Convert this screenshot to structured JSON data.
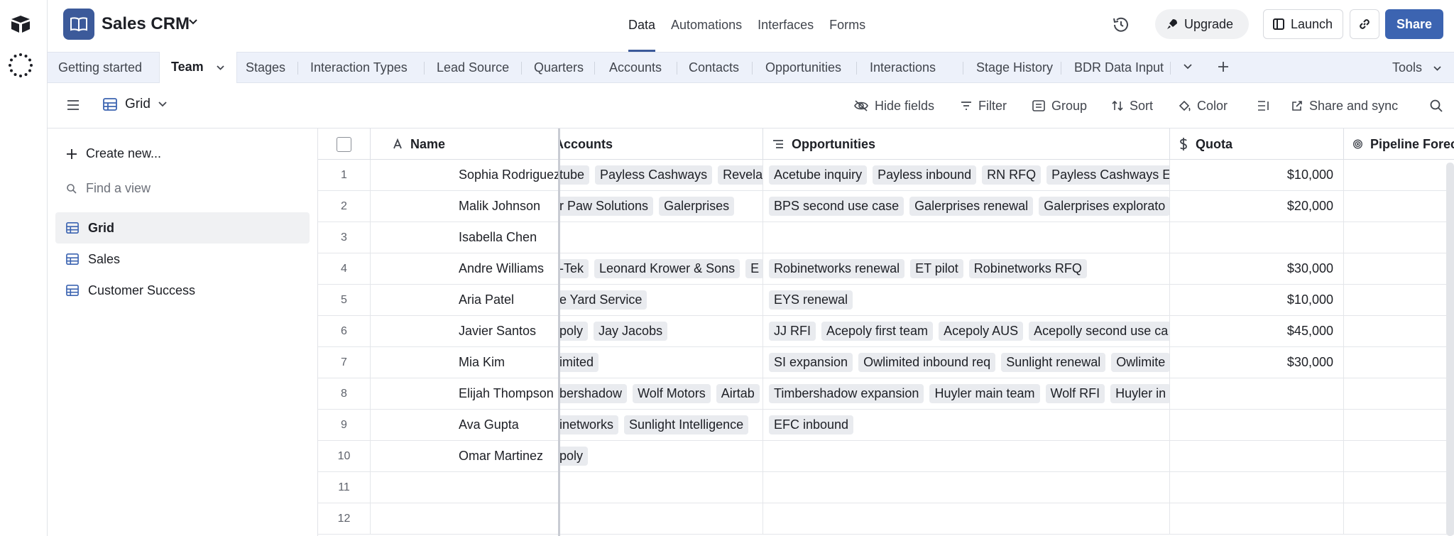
{
  "app": {
    "base_name": "Sales CRM",
    "nav": [
      {
        "label": "Data",
        "active": true
      },
      {
        "label": "Automations",
        "active": false
      },
      {
        "label": "Interfaces",
        "active": false
      },
      {
        "label": "Forms",
        "active": false
      }
    ],
    "upgrade_label": "Upgrade",
    "launch_label": "Launch",
    "share_label": "Share"
  },
  "tabs": {
    "items": [
      {
        "label": "Getting started"
      },
      {
        "label": "Team",
        "active": true
      },
      {
        "label": "Stages"
      },
      {
        "label": "Interaction Types"
      },
      {
        "label": "Lead Source"
      },
      {
        "label": "Quarters"
      },
      {
        "label": "Accounts"
      },
      {
        "label": "Contacts"
      },
      {
        "label": "Opportunities"
      },
      {
        "label": "Interactions"
      },
      {
        "label": "Stage History"
      },
      {
        "label": "BDR Data Input"
      }
    ],
    "tools_label": "Tools"
  },
  "viewbar": {
    "view_name": "Grid",
    "hide_fields": "Hide fields",
    "filter": "Filter",
    "group": "Group",
    "sort": "Sort",
    "color": "Color",
    "share_sync": "Share and sync"
  },
  "sidebar": {
    "create_new": "Create new...",
    "find_placeholder": "Find a view",
    "views": [
      {
        "label": "Grid",
        "active": true
      },
      {
        "label": "Sales",
        "active": false
      },
      {
        "label": "Customer Success",
        "active": false
      }
    ]
  },
  "grid": {
    "columns": {
      "name": "Name",
      "accounts": "Accounts",
      "opportunities": "Opportunities",
      "quota": "Quota",
      "pipeline": "Pipeline Forec"
    },
    "rows": [
      {
        "num": "1",
        "name": "Sophia Rodriguez",
        "accounts": [
          "tube",
          "Payless Cashways",
          "Revela"
        ],
        "opps": [
          "Acetube inquiry",
          "Payless inbound",
          "RN RFQ",
          "Payless Cashways E"
        ],
        "quota": "$10,000"
      },
      {
        "num": "2",
        "name": "Malik Johnson",
        "accounts": [
          "r Paw Solutions",
          "Galerprises"
        ],
        "opps": [
          "BPS second use case",
          "Galerprises renewal",
          "Galerprises explorato"
        ],
        "quota": "$20,000"
      },
      {
        "num": "3",
        "name": "Isabella Chen",
        "accounts": [],
        "opps": [],
        "quota": ""
      },
      {
        "num": "4",
        "name": "Andre Williams",
        "accounts": [
          "-Tek",
          "Leonard Krower & Sons",
          "E"
        ],
        "opps": [
          "Robinetworks renewal",
          "ET pilot",
          "Robinetworks RFQ"
        ],
        "quota": "$30,000"
      },
      {
        "num": "5",
        "name": "Aria Patel",
        "accounts": [
          "e Yard Service"
        ],
        "opps": [
          "EYS renewal"
        ],
        "quota": "$10,000"
      },
      {
        "num": "6",
        "name": "Javier Santos",
        "accounts": [
          "poly",
          "Jay Jacobs"
        ],
        "opps": [
          "JJ RFI",
          "Acepoly first team",
          "Acepoly AUS",
          "Acepolly second use ca"
        ],
        "quota": "$45,000"
      },
      {
        "num": "7",
        "name": "Mia Kim",
        "accounts": [
          "imited"
        ],
        "opps": [
          "SI expansion",
          "Owlimited inbound req",
          "Sunlight renewal",
          "Owlimite"
        ],
        "quota": "$30,000"
      },
      {
        "num": "8",
        "name": "Elijah Thompson",
        "accounts": [
          "bershadow",
          "Wolf Motors",
          "Airtab"
        ],
        "opps": [
          "Timbershadow expansion",
          "Huyler main team",
          "Wolf RFI",
          "Huyler in"
        ],
        "quota": ""
      },
      {
        "num": "9",
        "name": "Ava Gupta",
        "accounts": [
          "inetworks",
          "Sunlight Intelligence"
        ],
        "opps": [
          "EFC inbound"
        ],
        "quota": ""
      },
      {
        "num": "10",
        "name": "Omar Martinez",
        "accounts": [
          "poly"
        ],
        "opps": [],
        "quota": ""
      },
      {
        "num": "11",
        "name": "",
        "accounts": [],
        "opps": [],
        "quota": ""
      },
      {
        "num": "12",
        "name": "",
        "accounts": [],
        "opps": [],
        "quota": ""
      }
    ]
  },
  "colors": {
    "accent": "#3c5a9a",
    "share": "#3c64b1",
    "tabbar_bg": "#edf1fa",
    "pill_bg": "#e9ebef"
  }
}
